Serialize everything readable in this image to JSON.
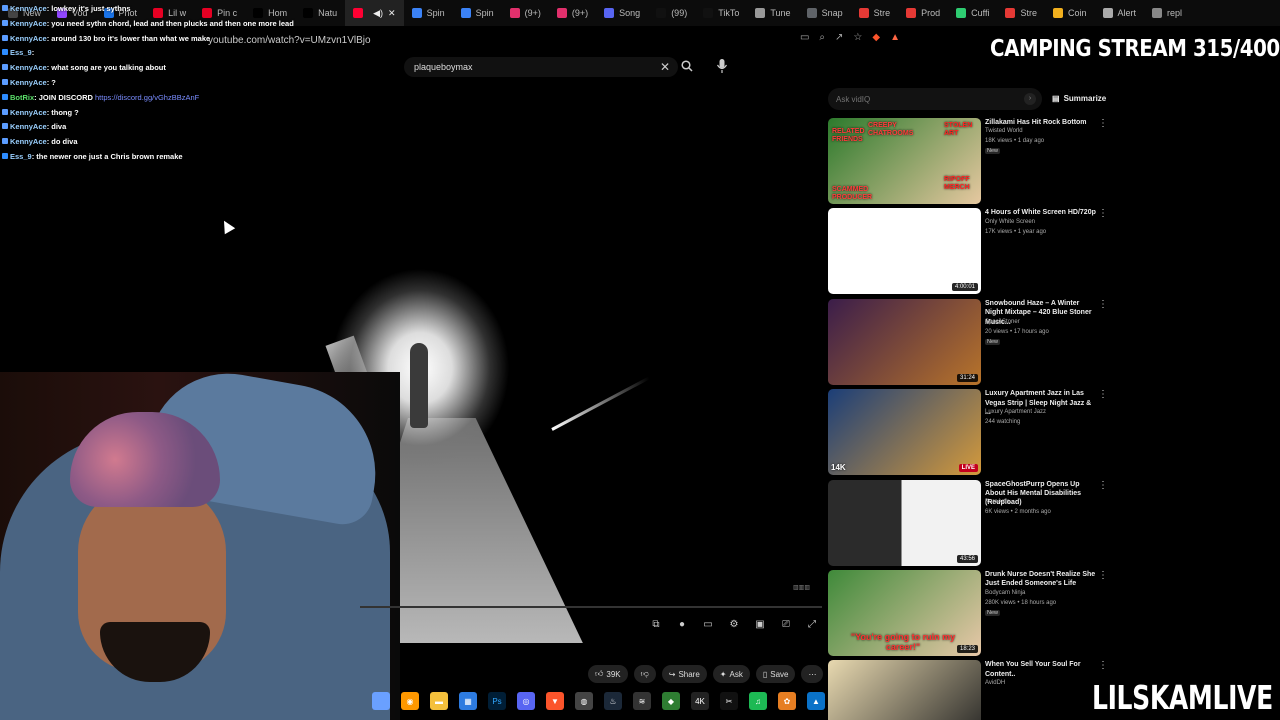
{
  "tabs": [
    {
      "label": "New",
      "color": "#444444"
    },
    {
      "label": "Vod",
      "color": "#9147ff"
    },
    {
      "label": "Phot",
      "color": "#1a73e8"
    },
    {
      "label": "Lil w",
      "color": "#e60023"
    },
    {
      "label": "Pin c",
      "color": "#e60023"
    },
    {
      "label": "Hom",
      "color": "#000000"
    },
    {
      "label": "Natu",
      "color": "#000000"
    },
    {
      "label": "",
      "color": "#ff0033",
      "active": true
    },
    {
      "label": "Spin",
      "color": "#3b82f6"
    },
    {
      "label": "Spin",
      "color": "#3b82f6"
    },
    {
      "label": "(9+)",
      "color": "#e1306c"
    },
    {
      "label": "(9+)",
      "color": "#e1306c"
    },
    {
      "label": "Song",
      "color": "#5865f2"
    },
    {
      "label": "(99)",
      "color": "#111111"
    },
    {
      "label": "TikTo",
      "color": "#111111"
    },
    {
      "label": "Tune",
      "color": "#999999"
    },
    {
      "label": "Snap",
      "color": "#5f6368"
    },
    {
      "label": "Stre",
      "color": "#e53935"
    },
    {
      "label": "Prod",
      "color": "#e53935"
    },
    {
      "label": "Cuffi",
      "color": "#2ecc71"
    },
    {
      "label": "Stre",
      "color": "#e53935"
    },
    {
      "label": "Coin",
      "color": "#f2b01e"
    },
    {
      "label": "Alert",
      "color": "#aaaaaa"
    },
    {
      "label": "repl",
      "color": "#888888"
    }
  ],
  "address_bar": {
    "url": "youtube.com/watch?v=UMzvn1VlBjo"
  },
  "search": {
    "value": "plaqueboymax"
  },
  "overlay": {
    "stream_title": "CAMPING STREAM 315/400",
    "brand": "LILSKAMLIVE"
  },
  "chat": [
    {
      "user": "KennyAce",
      "message": ": lowkey it's just sythns",
      "badge": "#5b9cff",
      "bot": false
    },
    {
      "user": "KennyAce",
      "message": ": you need sythn chord, lead and then plucks and then one more lead",
      "badge": "#5b9cff",
      "bot": false
    },
    {
      "user": "KennyAce",
      "message": ": around 130 bro it's lower than what we make",
      "badge": "#5b9cff",
      "bot": false
    },
    {
      "user": "Ess_9",
      "message": ":",
      "badge": "#2d8cff",
      "bot": false
    },
    {
      "user": "KennyAce",
      "message": ": what song are you talking about",
      "badge": "#5b9cff",
      "bot": false
    },
    {
      "user": "KennyAce",
      "message": ": ?",
      "badge": "#5b9cff",
      "bot": false
    },
    {
      "user": "BotRix",
      "message": ": JOIN DISCORD ",
      "link": "https://discord.gg/vGhzBBzAnF",
      "badge": "#2d8cff",
      "bot": true
    },
    {
      "user": "KennyAce",
      "message": ": thong ?",
      "badge": "#5b9cff",
      "bot": false
    },
    {
      "user": "KennyAce",
      "message": ": diva",
      "badge": "#5b9cff",
      "bot": false
    },
    {
      "user": "KennyAce",
      "message": ": do diva",
      "badge": "#5b9cff",
      "bot": false
    },
    {
      "user": "Ess_9",
      "message": ": the newer one just a Chris brown remake",
      "badge": "#2d8cff",
      "bot": false
    }
  ],
  "actions": {
    "likes": "39K",
    "share": "Share",
    "ask": "Ask",
    "save": "Save"
  },
  "sidebar": {
    "ask_placeholder": "Ask vidIQ",
    "summarize": "Summarize"
  },
  "recommendations": [
    {
      "title": "Zillakami Has Hit Rock Bottom",
      "channel": "Twisted World",
      "meta": "18K views • 1 day ago",
      "new": "New",
      "duration": "",
      "thumb": [
        "#2c7a2c",
        "#e6c8a0"
      ],
      "labels": [
        "CREEPY CHATROOMS",
        "STOLEN ART",
        "RIPOFF MERCH",
        "SCAMMED PRODUCER",
        "RELATED FRIENDS"
      ]
    },
    {
      "title": "4 Hours of White Screen HD/720p",
      "channel": "Only White Screen",
      "meta": "17K views • 1 year ago",
      "new": "",
      "duration": "4:00:01",
      "thumb": [
        "#ffffff",
        "#ffffff"
      ],
      "labels": []
    },
    {
      "title": "Snowbound Haze – A Winter Night Mixtape – 420 Blue Stoner Music...",
      "channel": "SpaceStoner",
      "meta": "20 views • 17 hours ago",
      "new": "New",
      "duration": "31:24",
      "thumb": [
        "#3b1d4a",
        "#b8742a"
      ],
      "labels": []
    },
    {
      "title": "Luxury Apartment Jazz in Las Vegas Strip | Sleep Night Jazz & ...",
      "channel": "Luxury Apartment Jazz",
      "meta": "244 watching",
      "new": "",
      "duration": "LIVE",
      "quality": "14K",
      "thumb": [
        "#1b3e78",
        "#d49a3c"
      ],
      "labels": []
    },
    {
      "title": "SpaceGhostPurrp Opens Up About His Mental Disabilities (Reupload)",
      "channel": "KoreArtis",
      "meta": "6K views • 2 months ago",
      "new": "",
      "duration": "43:56",
      "thumb": [
        "#2b2b2b",
        "#f2f2f2"
      ],
      "labels": []
    },
    {
      "title": "Drunk Nurse Doesn't Realize She Just Ended Someone's Life",
      "channel": "Bodycam Ninja",
      "meta": "280K views • 18 hours ago",
      "new": "New",
      "duration": "18:23",
      "thumb": [
        "#3f8a3a",
        "#e8c8a8"
      ],
      "labels": [
        "\"You're going to ruin my career!\""
      ]
    },
    {
      "title": "When You Sell Your Soul For Content..",
      "channel": "AvidDH",
      "meta": "",
      "new": "",
      "duration": "",
      "thumb": [
        "#e8d9b0",
        "#222222"
      ],
      "labels": []
    }
  ]
}
